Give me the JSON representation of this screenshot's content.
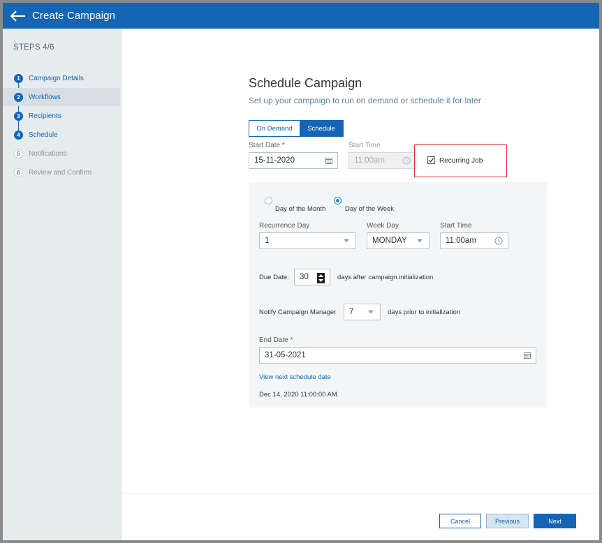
{
  "header": {
    "title": "Create Campaign"
  },
  "sidebar": {
    "steps_label": "STEPS 4/6",
    "steps": [
      {
        "num": "1",
        "label": "Campaign Details",
        "state": "done"
      },
      {
        "num": "2",
        "label": "Workflows",
        "state": "done"
      },
      {
        "num": "3",
        "label": "Recipients",
        "state": "done"
      },
      {
        "num": "4",
        "label": "Schedule",
        "state": "done"
      },
      {
        "num": "5",
        "label": "Notifications",
        "state": "todo"
      },
      {
        "num": "6",
        "label": "Review and Confirm",
        "state": "todo"
      }
    ]
  },
  "main": {
    "title": "Schedule Campaign",
    "subtitle": "Set up your campaign to run on demand or schedule it for later",
    "tabs": {
      "on_demand": "On Demand",
      "schedule": "Schedule"
    },
    "start_date": {
      "label": "Start Date",
      "required": "*",
      "value": "15-11-2020"
    },
    "start_time": {
      "label": "Start Time",
      "value": "11:00am"
    },
    "recurring_job": {
      "label": "Recurring Job",
      "checked": true
    },
    "panel": {
      "day_of_month_label": "Day of the Month",
      "day_of_week_label": "Day of the Week",
      "recurrence_day": {
        "label": "Recurrence Day",
        "value": "1"
      },
      "week_day": {
        "label": "Week Day",
        "value": "MONDAY"
      },
      "start_time": {
        "label": "Start Time",
        "value": "11:00am"
      },
      "due_date": {
        "label": "Due Date:",
        "value": "30",
        "suffix": "days after campaign initialization"
      },
      "notify": {
        "label": "Notify Campaign Manager",
        "value": "7",
        "suffix": "days prior to initialization"
      },
      "end_date": {
        "label": "End Date",
        "required": "*",
        "value": "31-05-2021"
      },
      "view_next_link": "View next schedule date",
      "next_date": "Dec 14, 2020 11:00:00 AM"
    }
  },
  "footer": {
    "cancel": "Cancel",
    "previous": "Previous",
    "next": "Next"
  },
  "colors": {
    "brand": "#1565b5",
    "highlight": "#d93030",
    "panel": "#f3f6f7",
    "sidebar": "#e6ebee"
  }
}
